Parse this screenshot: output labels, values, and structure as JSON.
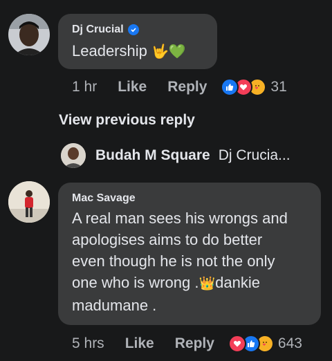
{
  "comment1": {
    "author": "Dj Crucial",
    "text": "Leadership",
    "emoji": "🤟💚",
    "time": "1 hr",
    "like": "Like",
    "reply": "Reply",
    "reaction_count": "31"
  },
  "view_previous": "View previous reply",
  "reply_preview": {
    "author": "Budah M Square",
    "text": "Dj Crucia..."
  },
  "comment2": {
    "author": "Mac Savage",
    "lines": [
      "A real man sees his wrongs and",
      "apologises aims to do better",
      "even though he is not the only",
      "one who is wrong .",
      "madumane ."
    ],
    "line4_tail": "dankie",
    "emoji": "👑",
    "time": "5 hrs",
    "like": "Like",
    "reply": "Reply",
    "reaction_count": "643"
  },
  "colors": {
    "background": "#18191a",
    "bubble": "#3a3b3c",
    "secondary_text": "#b0b3b8",
    "like_blue": "#1877f2",
    "love_red": "#f33e58",
    "care_yellow": "#f7b125"
  },
  "icons": [
    "verified-badge-icon",
    "like-reaction-icon",
    "love-reaction-icon",
    "care-reaction-icon",
    "crown-emoji"
  ]
}
